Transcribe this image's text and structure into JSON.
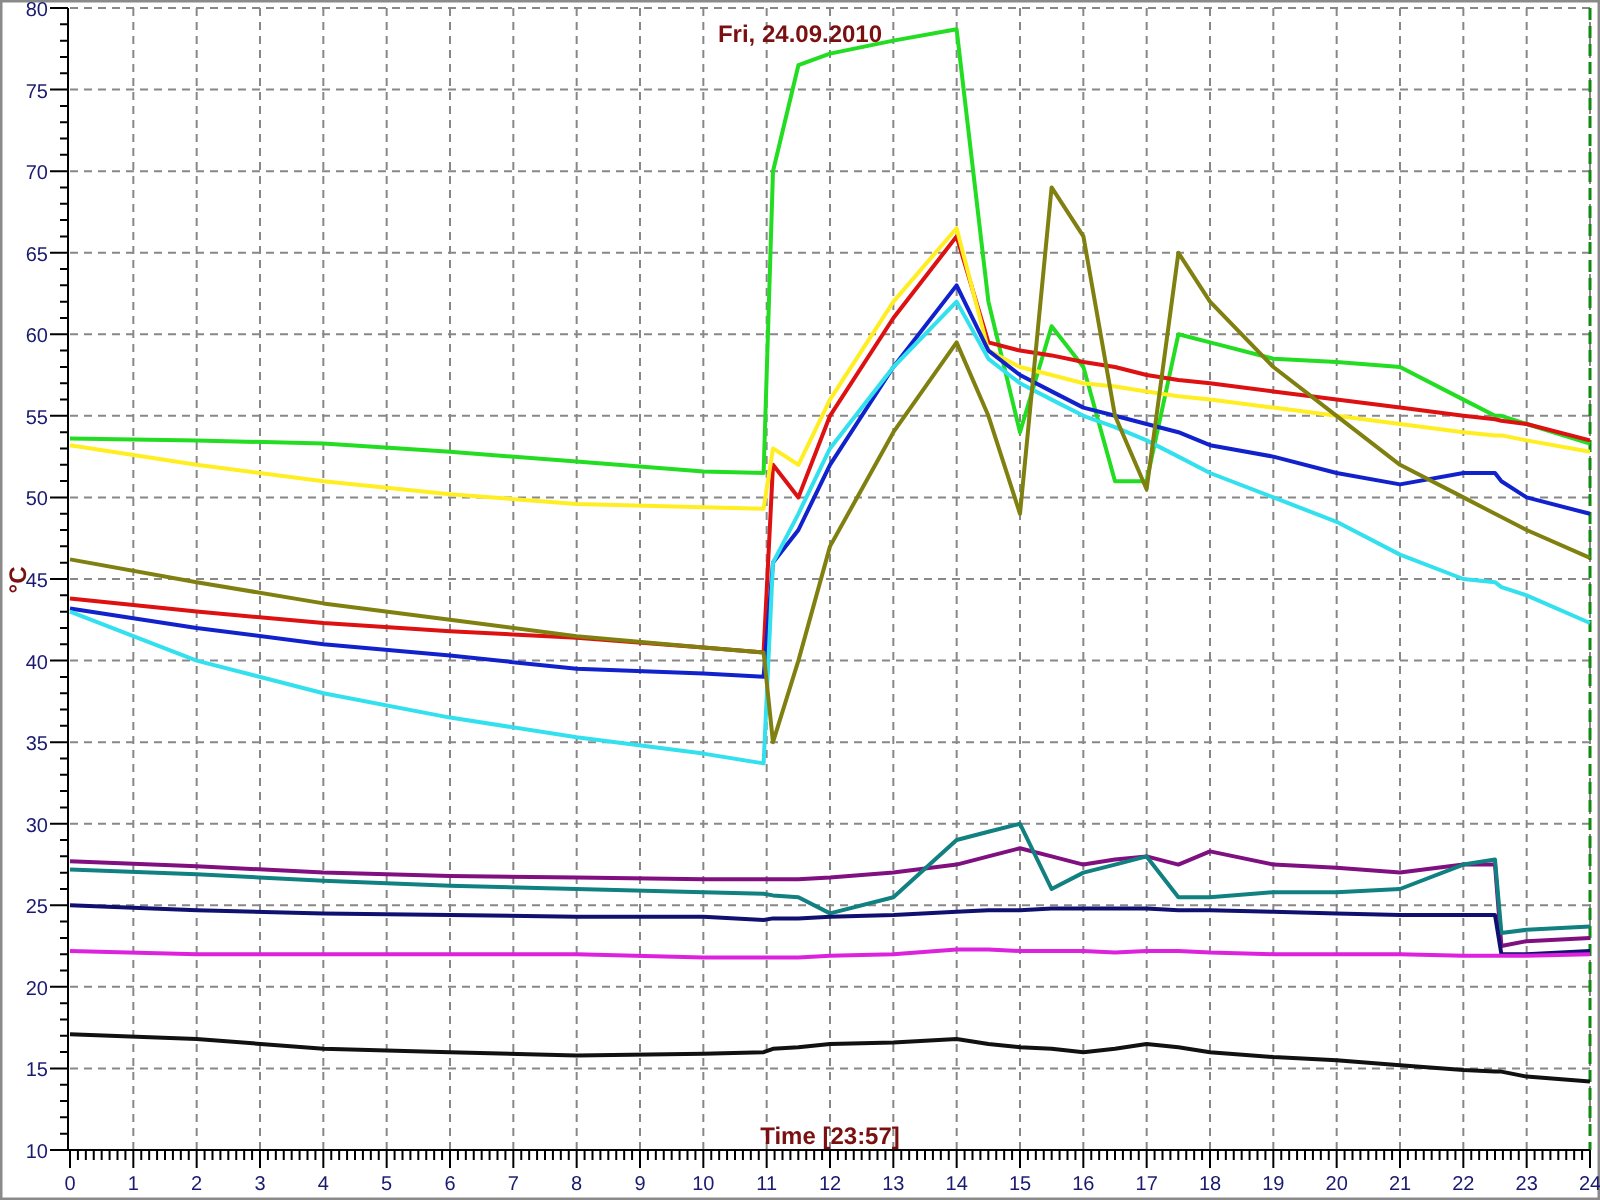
{
  "chart": {
    "chart_data": {
      "type": "line",
      "title": "Fri, 24.09.2010",
      "xlabel": "Time [23:57]",
      "ylabel": "°C",
      "x": [
        0,
        2,
        4,
        6,
        8,
        10,
        10.95,
        11.1,
        11.5,
        12,
        13,
        14,
        14.5,
        15,
        15.5,
        16,
        16.5,
        17,
        17.5,
        18,
        19,
        20,
        21,
        22,
        22.5,
        22.6,
        23,
        24
      ],
      "series": [
        {
          "color": "#22dd22",
          "values": [
            53.6,
            53.5,
            53.3,
            52.8,
            52.2,
            51.6,
            51.5,
            70,
            76.5,
            77.2,
            78,
            78.7,
            62,
            54,
            60.5,
            58,
            51,
            51,
            60,
            59.5,
            58.5,
            58.3,
            58,
            56,
            55,
            55,
            54.5,
            53.3
          ]
        },
        {
          "color": "#dd1111",
          "values": [
            43.8,
            43,
            42.3,
            41.8,
            41.4,
            40.8,
            40.5,
            52,
            50,
            55,
            61,
            66,
            59.5,
            59,
            58.7,
            58.3,
            58,
            57.5,
            57.2,
            57,
            56.5,
            56,
            55.5,
            55,
            54.8,
            54.7,
            54.5,
            53.5
          ]
        },
        {
          "color": "#ffee22",
          "values": [
            53.2,
            52,
            51,
            50.2,
            49.6,
            49.4,
            49.3,
            53,
            52,
            56,
            62,
            66.5,
            59,
            58,
            57.5,
            57,
            56.8,
            56.5,
            56.2,
            56,
            55.5,
            55,
            54.5,
            54,
            53.8,
            53.8,
            53.5,
            52.8
          ]
        },
        {
          "color": "#1122cc",
          "values": [
            43.2,
            42,
            41,
            40.3,
            39.5,
            39.2,
            39,
            46,
            48,
            52,
            58,
            63,
            59,
            57.5,
            56.5,
            55.5,
            55,
            54.5,
            54,
            53.2,
            52.5,
            51.5,
            50.8,
            51.5,
            51.5,
            51,
            50,
            49
          ]
        },
        {
          "color": "#33e0ee",
          "values": [
            43,
            40,
            38,
            36.5,
            35.3,
            34.3,
            33.7,
            46,
            49,
            53,
            58,
            62,
            58.5,
            57,
            56,
            55,
            54.3,
            53.5,
            52.5,
            51.5,
            50,
            48.5,
            46.5,
            45,
            44.8,
            44.5,
            44,
            42.3
          ]
        },
        {
          "color": "#808010",
          "values": [
            46.2,
            44.8,
            43.5,
            42.5,
            41.5,
            40.8,
            40.5,
            35,
            40,
            47,
            54,
            59.5,
            55,
            49,
            69,
            66,
            55,
            50.5,
            65,
            62,
            58,
            55,
            52,
            50,
            49,
            48.8,
            48,
            46.3
          ]
        },
        {
          "color": "#801080",
          "values": [
            27.7,
            27.4,
            27,
            26.8,
            26.7,
            26.6,
            26.6,
            26.6,
            26.6,
            26.7,
            27,
            27.5,
            28,
            28.5,
            28,
            27.5,
            27.8,
            28,
            27.5,
            28.3,
            27.5,
            27.3,
            27,
            27.5,
            27.5,
            22.5,
            22.8,
            23
          ]
        },
        {
          "color": "#108080",
          "values": [
            27.2,
            26.9,
            26.5,
            26.2,
            26,
            25.8,
            25.7,
            25.6,
            25.5,
            24.5,
            25.5,
            29,
            29.5,
            30,
            26,
            27,
            27.5,
            28,
            25.5,
            25.5,
            25.8,
            25.8,
            26,
            27.5,
            27.8,
            23.3,
            23.5,
            23.7
          ]
        },
        {
          "color": "#101070",
          "values": [
            25,
            24.7,
            24.5,
            24.4,
            24.3,
            24.3,
            24.1,
            24.2,
            24.2,
            24.3,
            24.4,
            24.6,
            24.7,
            24.7,
            24.8,
            24.8,
            24.8,
            24.8,
            24.7,
            24.7,
            24.6,
            24.5,
            24.4,
            24.4,
            24.4,
            22,
            22,
            22.2
          ]
        },
        {
          "color": "#dd22dd",
          "values": [
            22.2,
            22,
            22,
            22,
            22,
            21.8,
            21.8,
            21.8,
            21.8,
            21.9,
            22,
            22.3,
            22.3,
            22.2,
            22.2,
            22.2,
            22.1,
            22.2,
            22.2,
            22.1,
            22,
            22,
            22,
            21.9,
            21.9,
            21.9,
            21.9,
            22
          ]
        },
        {
          "color": "#111111",
          "values": [
            17.1,
            16.8,
            16.2,
            16,
            15.8,
            15.9,
            16,
            16.2,
            16.3,
            16.5,
            16.6,
            16.8,
            16.5,
            16.3,
            16.2,
            16,
            16.2,
            16.5,
            16.3,
            16,
            15.7,
            15.5,
            15.2,
            14.9,
            14.8,
            14.8,
            14.5,
            14.2
          ]
        }
      ],
      "xlim": [
        0,
        24
      ],
      "ylim": [
        10,
        80
      ],
      "xticks": [
        0,
        1,
        2,
        3,
        4,
        5,
        6,
        7,
        8,
        9,
        10,
        11,
        12,
        13,
        14,
        15,
        16,
        17,
        18,
        19,
        20,
        21,
        22,
        23,
        24
      ],
      "yticks": [
        10,
        15,
        20,
        25,
        30,
        35,
        40,
        45,
        50,
        55,
        60,
        65,
        70,
        75,
        80
      ],
      "grid": true
    }
  }
}
